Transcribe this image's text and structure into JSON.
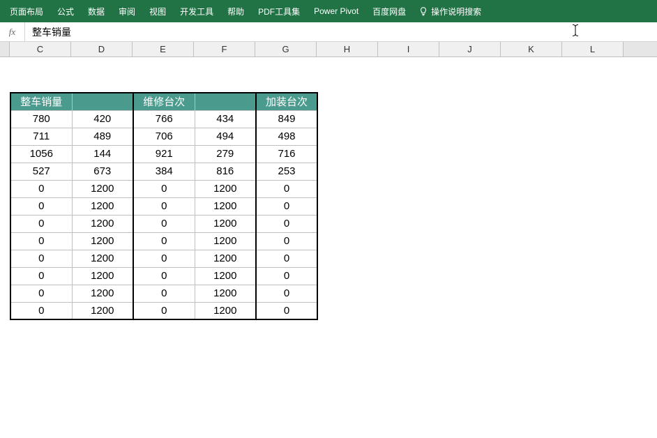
{
  "ribbon": {
    "tabs": [
      "页面布局",
      "公式",
      "数据",
      "审阅",
      "视图",
      "开发工具",
      "帮助",
      "PDF工具集",
      "Power Pivot",
      "百度网盘"
    ],
    "help_search": "操作说明搜索"
  },
  "formula_bar": {
    "fx": "fx",
    "value": "整车销量"
  },
  "columns": [
    "C",
    "D",
    "E",
    "F",
    "G",
    "H",
    "I",
    "J",
    "K",
    "L"
  ],
  "table": {
    "headers": [
      "整车销量",
      "",
      "维修台次",
      "",
      "加装台次"
    ],
    "rows": [
      [
        "780",
        "420",
        "766",
        "434",
        "849"
      ],
      [
        "711",
        "489",
        "706",
        "494",
        "498"
      ],
      [
        "1056",
        "144",
        "921",
        "279",
        "716"
      ],
      [
        "527",
        "673",
        "384",
        "816",
        "253"
      ],
      [
        "0",
        "1200",
        "0",
        "1200",
        "0"
      ],
      [
        "0",
        "1200",
        "0",
        "1200",
        "0"
      ],
      [
        "0",
        "1200",
        "0",
        "1200",
        "0"
      ],
      [
        "0",
        "1200",
        "0",
        "1200",
        "0"
      ],
      [
        "0",
        "1200",
        "0",
        "1200",
        "0"
      ],
      [
        "0",
        "1200",
        "0",
        "1200",
        "0"
      ],
      [
        "0",
        "1200",
        "0",
        "1200",
        "0"
      ],
      [
        "0",
        "1200",
        "0",
        "1200",
        "0"
      ]
    ]
  },
  "chart_data": {
    "type": "table",
    "headers": [
      "整车销量",
      "",
      "维修台次",
      "",
      "加装台次"
    ],
    "rows": [
      [
        780,
        420,
        766,
        434,
        849
      ],
      [
        711,
        489,
        706,
        494,
        498
      ],
      [
        1056,
        144,
        921,
        279,
        716
      ],
      [
        527,
        673,
        384,
        816,
        253
      ],
      [
        0,
        1200,
        0,
        1200,
        0
      ],
      [
        0,
        1200,
        0,
        1200,
        0
      ],
      [
        0,
        1200,
        0,
        1200,
        0
      ],
      [
        0,
        1200,
        0,
        1200,
        0
      ],
      [
        0,
        1200,
        0,
        1200,
        0
      ],
      [
        0,
        1200,
        0,
        1200,
        0
      ],
      [
        0,
        1200,
        0,
        1200,
        0
      ],
      [
        0,
        1200,
        0,
        1200,
        0
      ]
    ]
  }
}
